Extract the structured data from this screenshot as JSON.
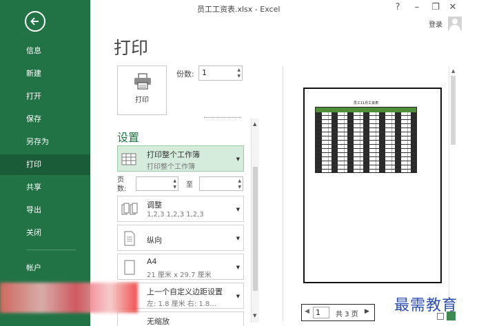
{
  "window": {
    "title": "员工工资表.xlsx - Excel",
    "help": "?",
    "minimize": "–",
    "restore": "❐",
    "close": "✕",
    "login": "登录"
  },
  "sidebar": {
    "items": [
      {
        "label": "信息"
      },
      {
        "label": "新建"
      },
      {
        "label": "打开"
      },
      {
        "label": "保存"
      },
      {
        "label": "另存为"
      },
      {
        "label": "打印"
      },
      {
        "label": "共享"
      },
      {
        "label": "导出"
      },
      {
        "label": "关闭"
      },
      {
        "label": "帐户"
      }
    ],
    "active_index": 5,
    "colors": {
      "bg": "#217346",
      "active": "#1a5c37"
    }
  },
  "print": {
    "title": "打印",
    "button_label": "打印",
    "copies_label": "份数:",
    "copies_value": "1"
  },
  "settings": {
    "title": "设置",
    "scope": {
      "main": "打印整个工作簿",
      "sub": "打印整个工作簿"
    },
    "pages_label": "页数:",
    "pages_to": "至",
    "collate": {
      "main": "调整",
      "sub": "1,2,3    1,2,3    1,2,3"
    },
    "orientation": {
      "main": "纵向"
    },
    "paper": {
      "main": "A4",
      "sub": "21 厘米 x 29.7 厘米"
    },
    "margins": {
      "main": "上一个自定义边距设置",
      "sub": "左: 1.8 厘米    右: 1.8..."
    },
    "scaling": {
      "main": "无缩放"
    }
  },
  "preview": {
    "sheet_title": "员工11月工资表",
    "current_page": "1",
    "total_pages": "共 3 页"
  },
  "watermark": "最需教育"
}
